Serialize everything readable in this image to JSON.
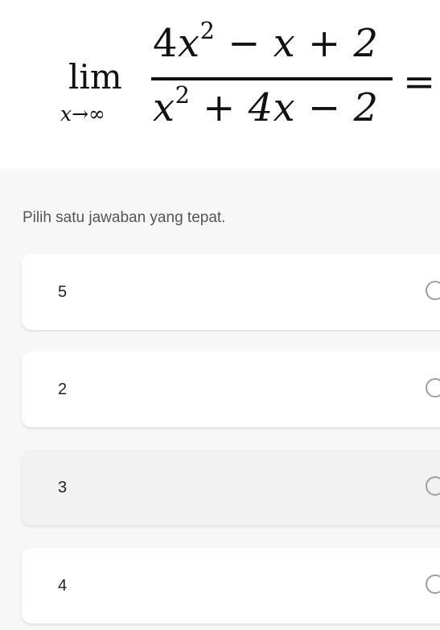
{
  "question": {
    "lim_word": "lim",
    "lim_sub": "x→∞",
    "numerator": {
      "coef": "4",
      "var": "x",
      "exp": "2",
      "rest": " − x + 2"
    },
    "denominator": {
      "var": "x",
      "exp": "2",
      "rest": " + 4x − 2"
    },
    "equals": "="
  },
  "instruction": "Pilih satu jawaban yang tepat.",
  "options": [
    {
      "label": "5",
      "selected": false
    },
    {
      "label": "2",
      "selected": false
    },
    {
      "label": "3",
      "selected": false
    },
    {
      "label": "4",
      "selected": false
    }
  ]
}
